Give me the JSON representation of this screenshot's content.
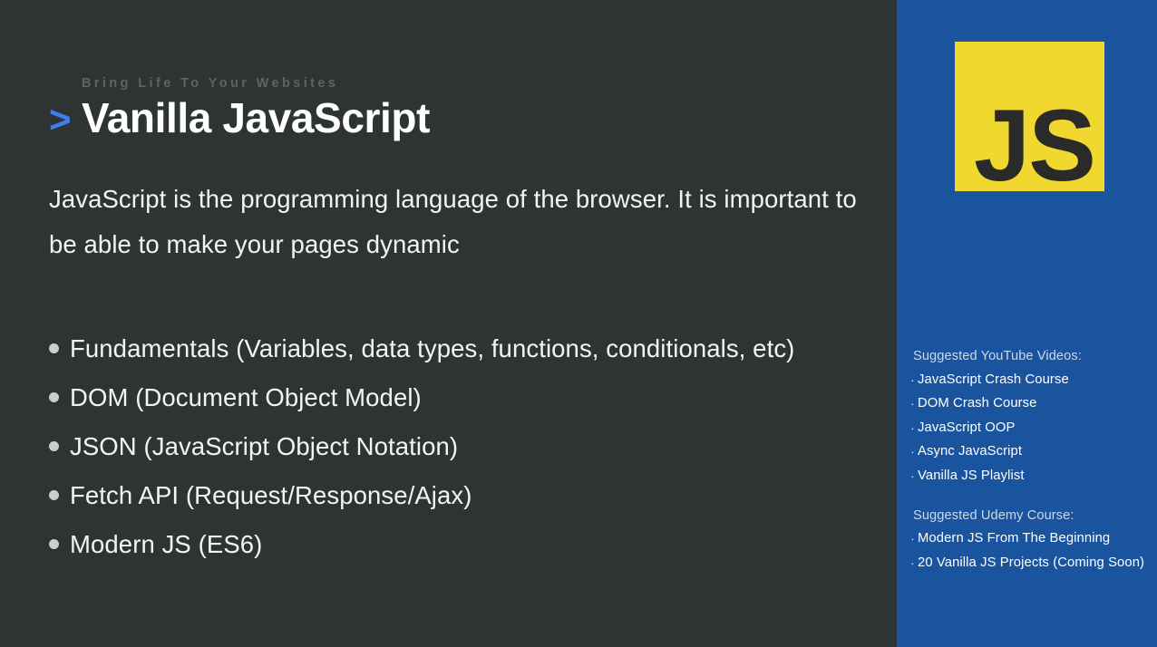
{
  "slide": {
    "kicker": "Bring Life To Your Websites",
    "chevron": ">",
    "title": "Vanilla JavaScript",
    "lead": "JavaScript is the programming language of the browser. It is important to be able to make your pages dynamic",
    "bullets": [
      "Fundamentals (Variables, data types, functions, conditionals, etc)",
      "DOM (Document Object Model)",
      "JSON (JavaScript Object Notation)",
      "Fetch API (Request/Response/Ajax)",
      "Modern JS (ES6)"
    ]
  },
  "sidebar": {
    "logo": {
      "text": "JS",
      "background_color": "#f0d82e",
      "text_color": "#2a2a28"
    },
    "groups": [
      {
        "title": "Suggested YouTube Videos:",
        "bullet_glyph": "·",
        "items": [
          "JavaScript Crash Course",
          "DOM Crash Course",
          "JavaScript OOP",
          "Async JavaScript",
          "Vanilla JS Playlist"
        ]
      },
      {
        "title": "Suggested Udemy Course:",
        "bullet_glyph": "·",
        "items": [
          "Modern JS From The Beginning",
          "20 Vanilla JS Projects (Coming Soon)"
        ]
      }
    ]
  },
  "colors": {
    "main_background": "#2e3434",
    "sidebar_background": "#1b549e",
    "accent_chevron": "#3d7ff0",
    "kicker_text": "#5c6563",
    "body_text": "#f2f4f3",
    "bullet_dot": "#c9cfcd",
    "sidebar_heading": "#cdd8e6",
    "sidebar_item": "#ffffff"
  }
}
